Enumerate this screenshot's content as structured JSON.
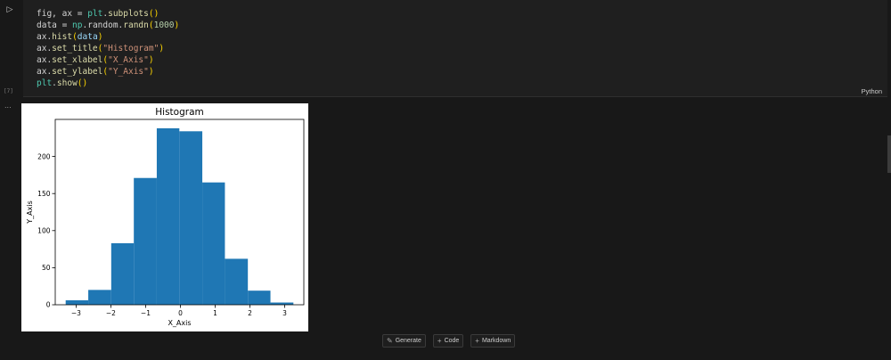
{
  "cell": {
    "run_icon": "play-icon",
    "execution_count": "[7]",
    "language": "Python",
    "output_menu": "..."
  },
  "code_lines": [
    [
      {
        "t": "fig, ax = ",
        "c": "#d4d4d4"
      },
      {
        "t": "plt",
        "c": "#4ec9b0"
      },
      {
        "t": ".",
        "c": "#d4d4d4"
      },
      {
        "t": "subplots",
        "c": "#dcdcaa"
      },
      {
        "t": "()",
        "c": "#ffd700"
      }
    ],
    [
      {
        "t": "data = ",
        "c": "#d4d4d4"
      },
      {
        "t": "np",
        "c": "#4ec9b0"
      },
      {
        "t": ".random.",
        "c": "#d4d4d4"
      },
      {
        "t": "randn",
        "c": "#dcdcaa"
      },
      {
        "t": "(",
        "c": "#ffd700"
      },
      {
        "t": "1000",
        "c": "#b5cea8"
      },
      {
        "t": ")",
        "c": "#ffd700"
      }
    ],
    [
      {
        "t": "ax.",
        "c": "#d4d4d4"
      },
      {
        "t": "hist",
        "c": "#dcdcaa"
      },
      {
        "t": "(",
        "c": "#ffd700"
      },
      {
        "t": "data",
        "c": "#9cdcfe"
      },
      {
        "t": ")",
        "c": "#ffd700"
      }
    ],
    [
      {
        "t": "ax.",
        "c": "#d4d4d4"
      },
      {
        "t": "set_title",
        "c": "#dcdcaa"
      },
      {
        "t": "(",
        "c": "#ffd700"
      },
      {
        "t": "\"Histogram\"",
        "c": "#ce9178"
      },
      {
        "t": ")",
        "c": "#ffd700"
      }
    ],
    [
      {
        "t": "ax.",
        "c": "#d4d4d4"
      },
      {
        "t": "set_xlabel",
        "c": "#dcdcaa"
      },
      {
        "t": "(",
        "c": "#ffd700"
      },
      {
        "t": "\"X_Axis\"",
        "c": "#ce9178"
      },
      {
        "t": ")",
        "c": "#ffd700"
      }
    ],
    [
      {
        "t": "ax.",
        "c": "#d4d4d4"
      },
      {
        "t": "set_ylabel",
        "c": "#dcdcaa"
      },
      {
        "t": "(",
        "c": "#ffd700"
      },
      {
        "t": "\"Y_Axis\"",
        "c": "#ce9178"
      },
      {
        "t": ")",
        "c": "#ffd700"
      }
    ],
    [
      {
        "t": "plt",
        "c": "#4ec9b0"
      },
      {
        "t": ".",
        "c": "#d4d4d4"
      },
      {
        "t": "show",
        "c": "#dcdcaa"
      },
      {
        "t": "()",
        "c": "#ffd700"
      }
    ]
  ],
  "chart_data": {
    "type": "bar",
    "title": "Histogram",
    "xlabel": "X_Axis",
    "ylabel": "Y_Axis",
    "bin_edges": [
      -3.3,
      -2.65,
      -1.99,
      -1.34,
      -0.68,
      -0.03,
      0.63,
      1.28,
      1.94,
      2.59,
      3.25
    ],
    "values": [
      6,
      20,
      83,
      171,
      238,
      234,
      165,
      62,
      19,
      3
    ],
    "xlim": [
      -3.6,
      3.55
    ],
    "ylim": [
      0,
      250
    ],
    "xticks": [
      -3,
      -2,
      -1,
      0,
      1,
      2,
      3
    ],
    "yticks": [
      0,
      50,
      100,
      150,
      200
    ],
    "bar_color": "#1f77b4",
    "grid": false,
    "legend": "none"
  },
  "toolbar": {
    "generate_label": "Generate",
    "code_label": "Code",
    "markdown_label": "Markdown"
  }
}
